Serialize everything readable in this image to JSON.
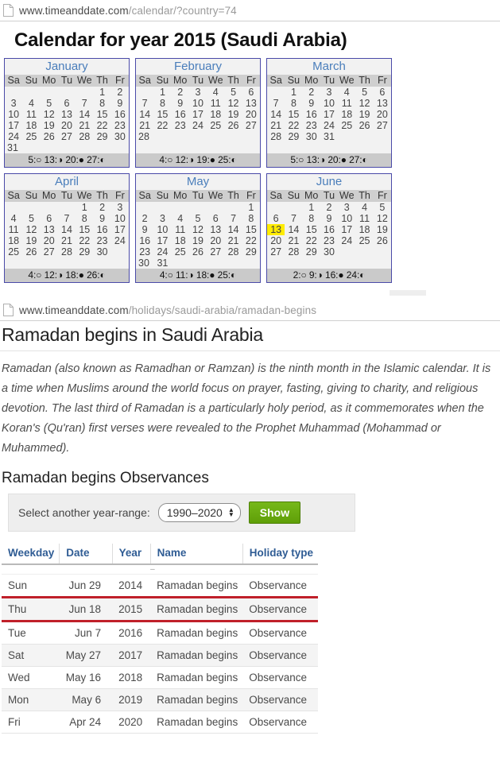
{
  "browser": {
    "urlbar1": {
      "prefix": "www.timeanddate.com",
      "path": "/calendar/?country=74",
      "icon": "page-icon"
    },
    "urlbar2": {
      "prefix": "www.timeanddate.com",
      "path": "/holidays/saudi-arabia/ramadan-begins",
      "icon": "page-icon"
    }
  },
  "calendar_page": {
    "title": "Calendar for year 2015 (Saudi Arabia)",
    "weekday_headers": [
      "Sa",
      "Su",
      "Mo",
      "Tu",
      "We",
      "Th",
      "Fr"
    ],
    "months": [
      {
        "name": "January",
        "weeks": [
          [
            "",
            "",
            "",
            "",
            "",
            "1",
            "2"
          ],
          [
            "3",
            "4",
            "5",
            "6",
            "7",
            "8",
            "9"
          ],
          [
            "10",
            "11",
            "12",
            "13",
            "14",
            "15",
            "16"
          ],
          [
            "17",
            "18",
            "19",
            "20",
            "21",
            "22",
            "23"
          ],
          [
            "24",
            "25",
            "26",
            "27",
            "28",
            "29",
            "30"
          ],
          [
            "31",
            "",
            "",
            "",
            "",
            "",
            ""
          ]
        ],
        "red_days": [
          "25"
        ],
        "yellow_days": [],
        "moon": "5:○ 13:◑ 20:● 27:◐"
      },
      {
        "name": "February",
        "weeks": [
          [
            "",
            "1",
            "2",
            "3",
            "4",
            "5",
            "6"
          ],
          [
            "7",
            "8",
            "9",
            "10",
            "11",
            "12",
            "13"
          ],
          [
            "14",
            "15",
            "16",
            "17",
            "18",
            "19",
            "20"
          ],
          [
            "21",
            "22",
            "23",
            "24",
            "25",
            "26",
            "27"
          ],
          [
            "28",
            "",
            "",
            "",
            "",
            "",
            ""
          ],
          [
            "",
            "",
            "",
            "",
            "",
            "",
            ""
          ]
        ],
        "red_days": [],
        "yellow_days": [],
        "moon": "4:○ 12:◑ 19:● 25:◐"
      },
      {
        "name": "March",
        "weeks": [
          [
            "",
            "1",
            "2",
            "3",
            "4",
            "5",
            "6"
          ],
          [
            "7",
            "8",
            "9",
            "10",
            "11",
            "12",
            "13"
          ],
          [
            "14",
            "15",
            "16",
            "17",
            "18",
            "19",
            "20"
          ],
          [
            "21",
            "22",
            "23",
            "24",
            "25",
            "26",
            "27"
          ],
          [
            "28",
            "29",
            "30",
            "31",
            "",
            "",
            ""
          ],
          [
            "",
            "",
            "",
            "",
            "",
            "",
            ""
          ]
        ],
        "red_days": [],
        "yellow_days": [],
        "moon": "5:○ 13:◑ 20:● 27:◐"
      },
      {
        "name": "April",
        "weeks": [
          [
            "",
            "",
            "",
            "",
            "1",
            "2",
            "3"
          ],
          [
            "4",
            "5",
            "6",
            "7",
            "8",
            "9",
            "10"
          ],
          [
            "11",
            "12",
            "13",
            "14",
            "15",
            "16",
            "17"
          ],
          [
            "18",
            "19",
            "20",
            "21",
            "22",
            "23",
            "24"
          ],
          [
            "25",
            "26",
            "27",
            "28",
            "29",
            "30",
            ""
          ],
          [
            "",
            "",
            "",
            "",
            "",
            "",
            ""
          ]
        ],
        "red_days": [],
        "yellow_days": [],
        "moon": "4:○ 12:◑ 18:● 26:◐"
      },
      {
        "name": "May",
        "weeks": [
          [
            "",
            "",
            "",
            "",
            "",
            "",
            "1"
          ],
          [
            "2",
            "3",
            "4",
            "5",
            "6",
            "7",
            "8"
          ],
          [
            "9",
            "10",
            "11",
            "12",
            "13",
            "14",
            "15"
          ],
          [
            "16",
            "17",
            "18",
            "19",
            "20",
            "21",
            "22"
          ],
          [
            "23",
            "24",
            "25",
            "26",
            "27",
            "28",
            "29"
          ],
          [
            "30",
            "31",
            "",
            "",
            "",
            "",
            ""
          ]
        ],
        "red_days": [],
        "yellow_days": [],
        "moon": "4:○ 11:◑ 18:● 25:◐"
      },
      {
        "name": "June",
        "weeks": [
          [
            "",
            "",
            "1",
            "2",
            "3",
            "4",
            "5"
          ],
          [
            "6",
            "7",
            "8",
            "9",
            "10",
            "11",
            "12"
          ],
          [
            "13",
            "14",
            "15",
            "16",
            "17",
            "18",
            "19"
          ],
          [
            "20",
            "21",
            "22",
            "23",
            "24",
            "25",
            "26"
          ],
          [
            "27",
            "28",
            "29",
            "30",
            "",
            "",
            ""
          ],
          [
            "",
            "",
            "",
            "",
            "",
            "",
            ""
          ]
        ],
        "red_days": [],
        "yellow_days": [
          "13"
        ],
        "moon": "2:○ 9:◑ 16:● 24:◐"
      }
    ]
  },
  "holiday_page": {
    "heading": "Ramadan begins in Saudi Arabia",
    "intro": "Ramadan (also known as Ramadhan or Ramzan) is the ninth month in the Islamic calendar. It is a time when Muslims around the world focus on prayer, fasting, giving to charity, and religious devotion. The last third of Ramadan is a particularly holy period, as it commemorates when the Koran's (Qu'ran) first verses were revealed to the Prophet Muhammad (Mohammad or Muhammed).",
    "observances_heading": "Ramadan begins Observances",
    "selector": {
      "label": "Select another year-range:",
      "selected_range": "1990–2020",
      "show_button": "Show"
    },
    "table": {
      "columns": [
        "Weekday",
        "Date",
        "Year",
        "Name",
        "Holiday type"
      ],
      "rows": [
        {
          "weekday": "Sun",
          "date": "Jun 29",
          "year": "2014",
          "name": "Ramadan begins",
          "type": "Observance"
        },
        {
          "weekday": "Thu",
          "date": "Jun 18",
          "year": "2015",
          "name": "Ramadan begins",
          "type": "Observance"
        },
        {
          "weekday": "Tue",
          "date": "Jun 7",
          "year": "2016",
          "name": "Ramadan begins",
          "type": "Observance"
        },
        {
          "weekday": "Sat",
          "date": "May 27",
          "year": "2017",
          "name": "Ramadan begins",
          "type": "Observance"
        },
        {
          "weekday": "Wed",
          "date": "May 16",
          "year": "2018",
          "name": "Ramadan begins",
          "type": "Observance"
        },
        {
          "weekday": "Mon",
          "date": "May 6",
          "year": "2019",
          "name": "Ramadan begins",
          "type": "Observance"
        },
        {
          "weekday": "Fri",
          "date": "Apr 24",
          "year": "2020",
          "name": "Ramadan begins",
          "type": "Observance"
        }
      ],
      "highlighted_year": "2015"
    }
  },
  "colors": {
    "month_name": "#4a7ebb",
    "month_border": "#4a4aa8",
    "weekday_header_bg": "#cfcfcf",
    "moon_row_bg": "#cacaca",
    "red_day": "#d0021b",
    "yellow_highlight": "#ffec00",
    "table_header_text": "#2f5c94",
    "highlight_rule": "#c0202a",
    "show_button": "#62a40a"
  }
}
